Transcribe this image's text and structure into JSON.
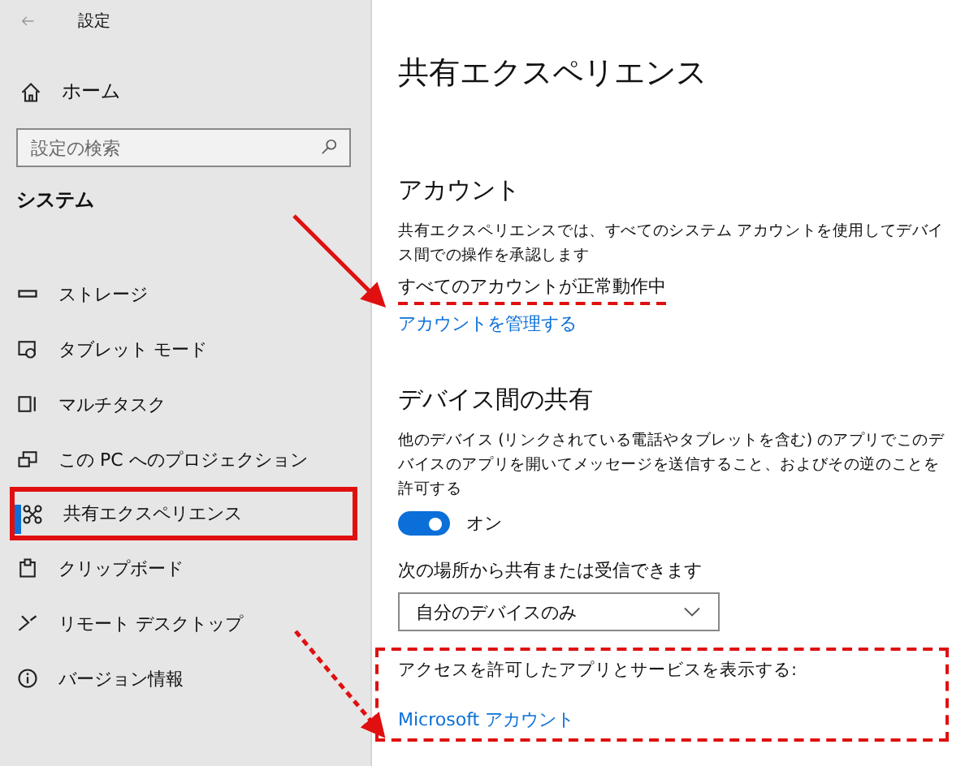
{
  "window": {
    "title": "設定"
  },
  "sidebar": {
    "home": "ホーム",
    "search": {
      "placeholder": "設定の検索"
    },
    "section": "システム",
    "items": [
      {
        "label": "ストレージ",
        "kind": "storage",
        "selected": false,
        "highlighted": false
      },
      {
        "label": "タブレット モード",
        "kind": "tablet",
        "selected": false,
        "highlighted": false
      },
      {
        "label": "マルチタスク",
        "kind": "multitask",
        "selected": false,
        "highlighted": false
      },
      {
        "label": "この PC へのプロジェクション",
        "kind": "project",
        "selected": false,
        "highlighted": false
      },
      {
        "label": "共有エクスペリエンス",
        "kind": "share",
        "selected": true,
        "highlighted": true
      },
      {
        "label": "クリップボード",
        "kind": "clipboard",
        "selected": false,
        "highlighted": false
      },
      {
        "label": "リモート デスクトップ",
        "kind": "remote",
        "selected": false,
        "highlighted": false
      },
      {
        "label": "バージョン情報",
        "kind": "info",
        "selected": false,
        "highlighted": false
      }
    ]
  },
  "page": {
    "title": "共有エクスペリエンス",
    "account": {
      "heading": "アカウント",
      "description": "共有エクスペリエンスでは、すべてのシステム アカウントを使用してデバイス間での操作を承認します",
      "status": "すべてのアカウントが正常動作中",
      "status_underlined": true,
      "link": "アカウントを管理する"
    },
    "sharing": {
      "heading": "デバイス間の共有",
      "description": "他のデバイス (リンクされている電話やタブレットを含む) のアプリでこのデバイスのアプリを開いてメッセージを送信すること、およびその逆のことを許可する",
      "toggle": {
        "on": true,
        "label": "オン"
      },
      "source_label": "次の場所から共有または受信できます",
      "dropdown": {
        "value": "自分のデバイスのみ"
      },
      "access_label": "アクセスを許可したアプリとサービスを表示する:",
      "access_link": "Microsoft アカウント",
      "access_outlined": true
    }
  },
  "annotation_arrows": [
    {
      "kind": "solid"
    },
    {
      "kind": "dashed"
    }
  ]
}
